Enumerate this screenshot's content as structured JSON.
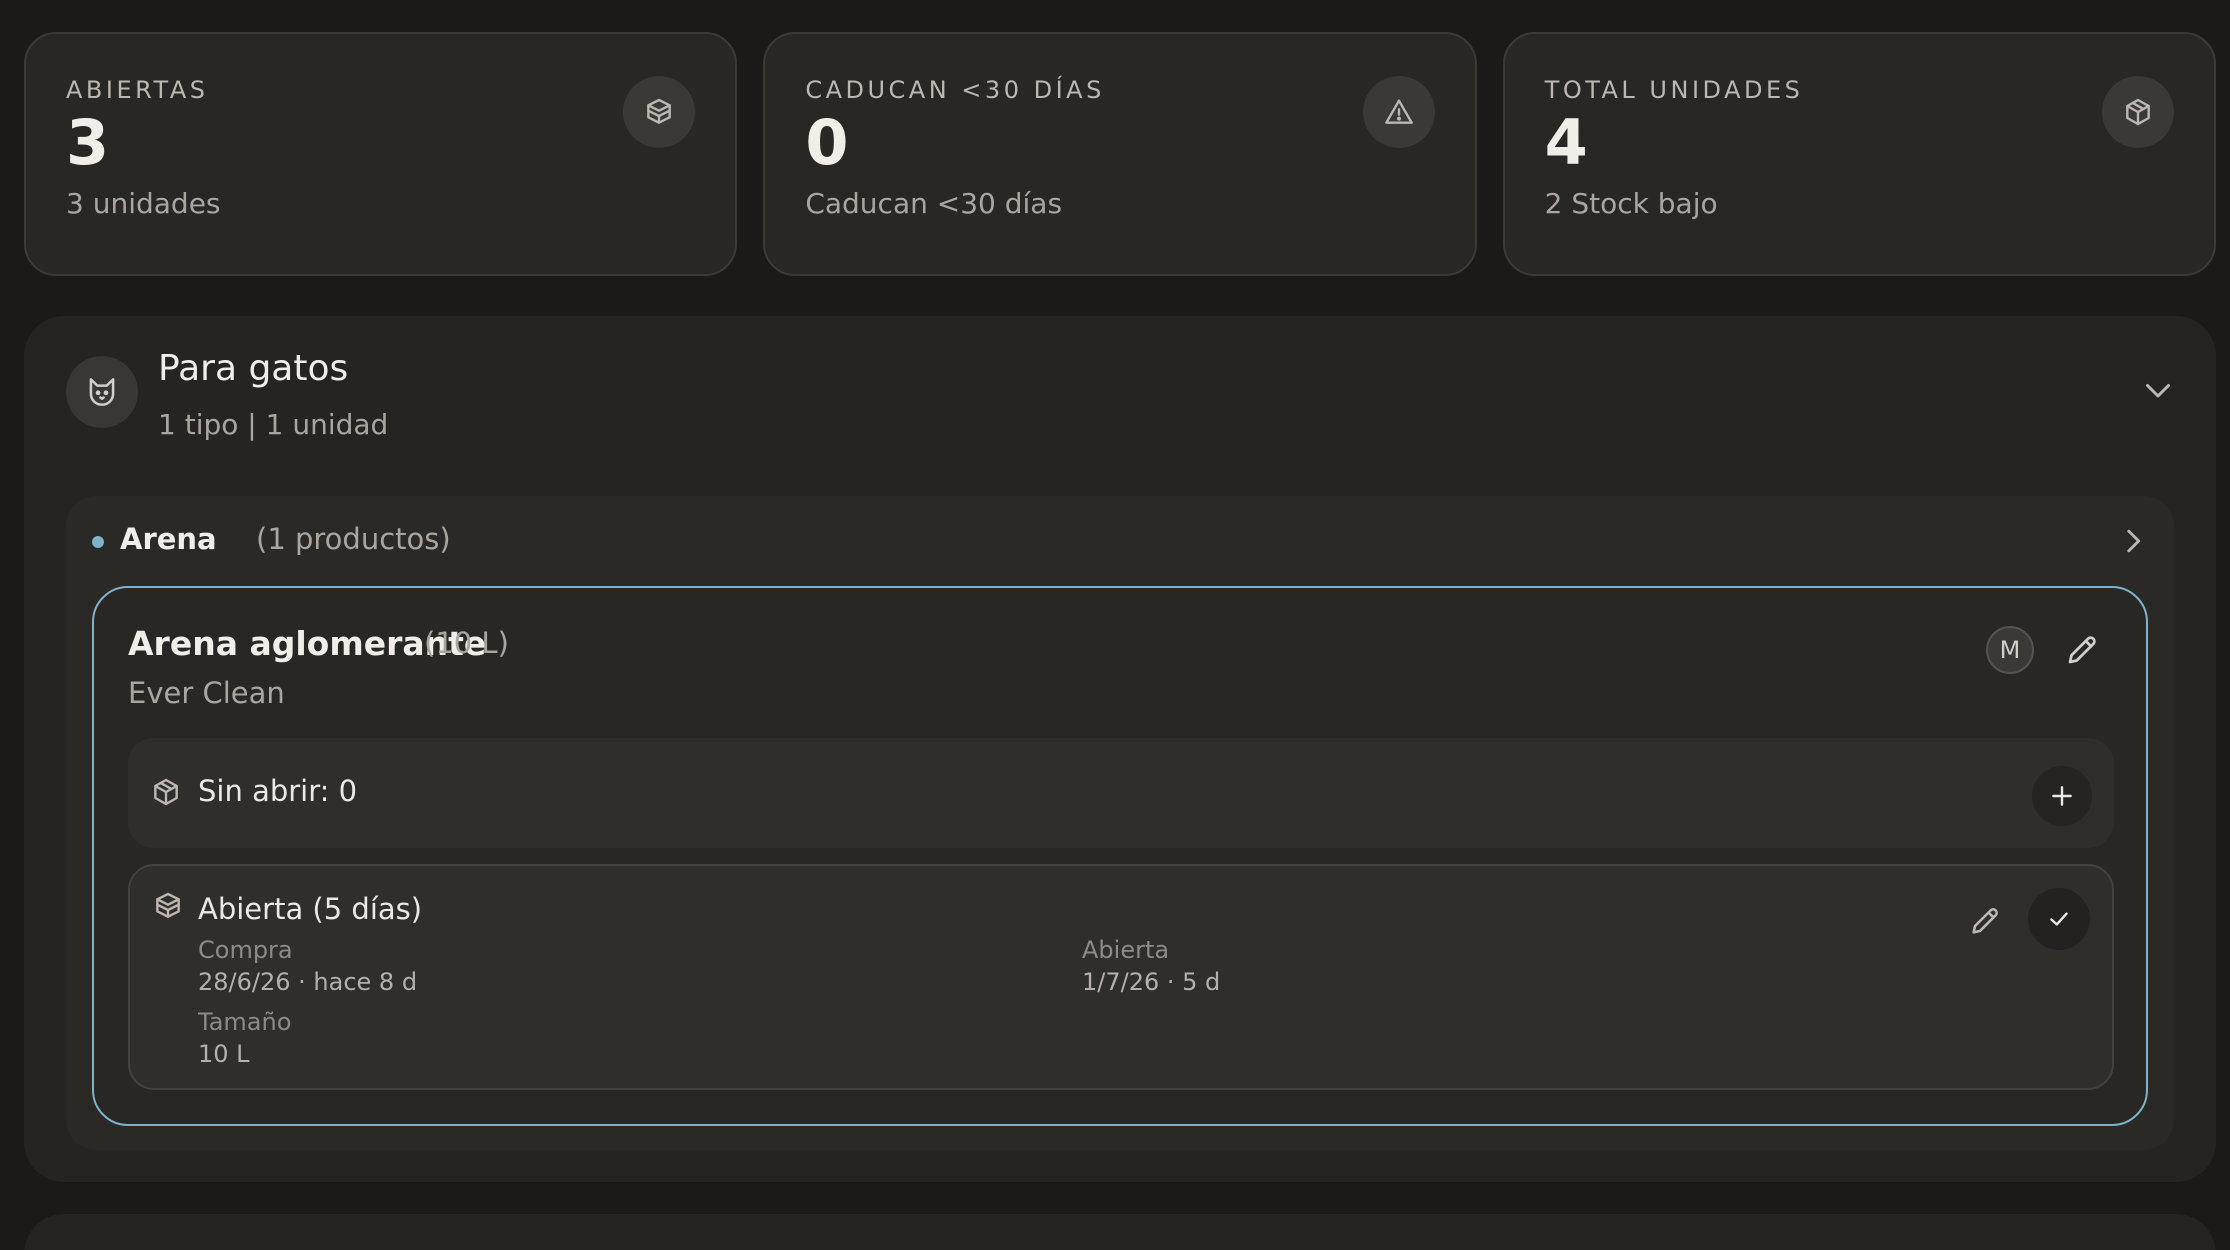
{
  "stats": [
    {
      "label": "ABIERTAS",
      "value": "3",
      "sub": "3 unidades",
      "icon": "open-box-icon"
    },
    {
      "label": "CADUCAN <30 DÍAS",
      "value": "0",
      "sub": "Caducan <30 días",
      "icon": "warning-icon"
    },
    {
      "label": "TOTAL UNIDADES",
      "value": "4",
      "sub": "2 Stock bajo",
      "icon": "box-icon"
    }
  ],
  "category": {
    "icon": "cat-icon",
    "title": "Para gatos",
    "subtitle": "1 tipo | 1 unidad",
    "subcategory": {
      "title": "Arena",
      "count": "(1 productos)",
      "product": {
        "name": "Arena aglomerante",
        "size": "(10 L)",
        "brand": "Ever Clean",
        "avatar": "M",
        "unopened": {
          "label": "Sin abrir: 0"
        },
        "opened": {
          "title": "Abierta (5 días)",
          "purchase_label": "Compra",
          "purchase_value": "28/6/26 · hace 8 d",
          "opened_label": "Abierta",
          "opened_value": "1/7/26 · 5 d",
          "size_label": "Tamaño",
          "size_value": "10 L"
        }
      }
    }
  },
  "colors": {
    "background": "#1b1a18",
    "card": "#282724",
    "accent": "#7eb3cc",
    "text": "#ece9e3",
    "muted": "#aaa69e"
  }
}
